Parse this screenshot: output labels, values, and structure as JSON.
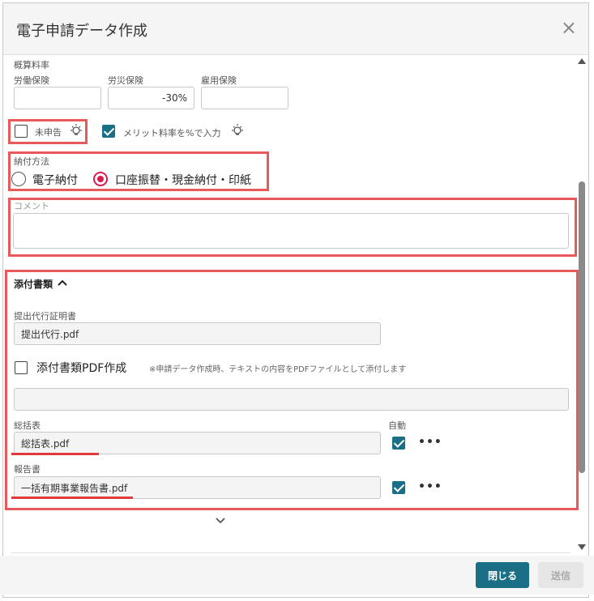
{
  "dialog": {
    "title": "電子申請データ作成",
    "close_icon": "×"
  },
  "rates": {
    "section_label": "概算料率",
    "labor_label": "労働保険",
    "accident_label": "労災保険",
    "employment_label": "雇用保険",
    "labor_value": "",
    "accident_value": "-30%",
    "employment_value": ""
  },
  "flags": {
    "undeclared_label": "未申告",
    "undeclared_checked": false,
    "merit_label": "メリット料率を%で入力",
    "merit_checked": true
  },
  "payment": {
    "label": "納付方法",
    "options": [
      "電子納付",
      "口座振替・現金納付・印紙"
    ],
    "selected": "口座振替・現金納付・印紙"
  },
  "comment": {
    "label": "コメント",
    "value": ""
  },
  "attachments": {
    "header": "添付書類",
    "proxy_cert_label": "提出代行証明書",
    "proxy_cert_value": "提出代行.pdf",
    "pdf_create_label": "添付書類PDF作成",
    "pdf_create_note": "※申請データ作成時、テキストの内容をPDFファイルとして添付します",
    "pdf_create_checked": false,
    "pdf_text_value": "",
    "summary_label": "総括表",
    "summary_value": "総括表.pdf",
    "auto_label": "自動",
    "summary_auto": true,
    "report_label": "報告書",
    "report_value": "一括有期事業報告書.pdf",
    "report_auto": true,
    "more_icon": "•••",
    "expand_icon": "chevron-down-icon"
  },
  "footer": {
    "close_label": "閉じる",
    "send_label": "送信"
  },
  "colors": {
    "accent": "#1a6e86",
    "radio_selected": "#d91b4c",
    "highlight": "#e85a5a"
  }
}
